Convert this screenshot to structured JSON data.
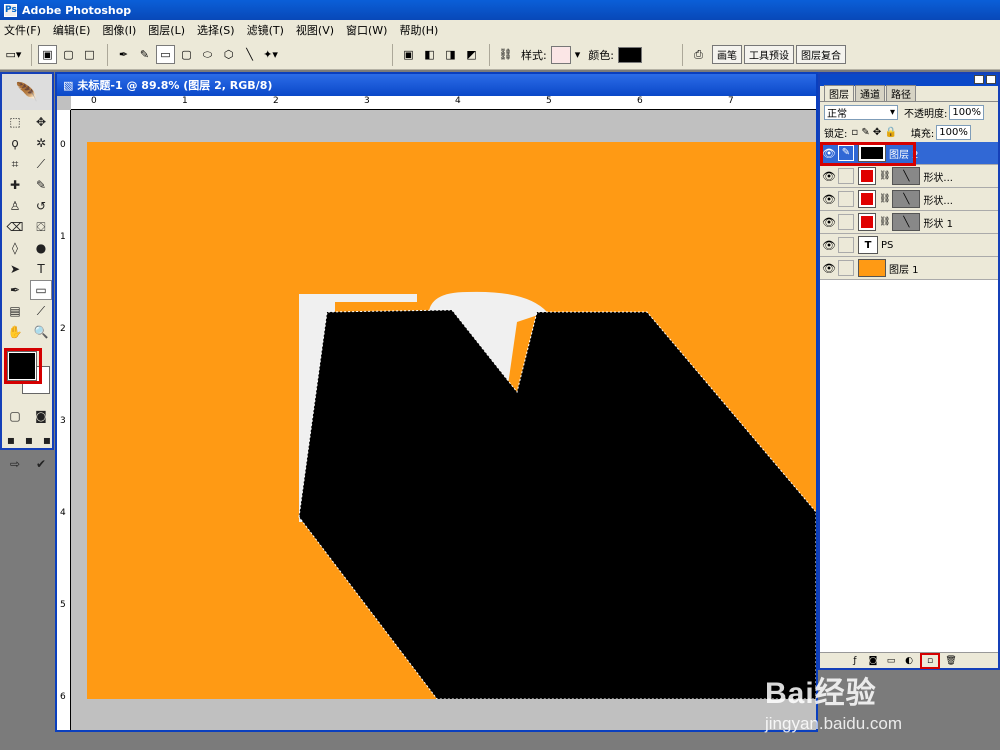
{
  "app": {
    "title": "Adobe Photoshop"
  },
  "menu": [
    "文件(F)",
    "编辑(E)",
    "图像(I)",
    "图层(L)",
    "选择(S)",
    "滤镜(T)",
    "视图(V)",
    "窗口(W)",
    "帮助(H)"
  ],
  "options": {
    "style_label": "样式:",
    "color_label": "颜色:",
    "wells": [
      "画笔",
      "工具预设",
      "图层复合"
    ]
  },
  "document": {
    "title": "未标题-1 @ 89.8% (图层 2, RGB/8)",
    "ruler_top": [
      "0",
      "1",
      "2",
      "3",
      "4",
      "5",
      "6",
      "7"
    ],
    "ruler_left": [
      "0",
      "1",
      "2",
      "3",
      "4",
      "5",
      "6"
    ]
  },
  "layers_panel": {
    "tabs": [
      "图层",
      "通道",
      "路径"
    ],
    "blend_mode": "正常",
    "opacity_label": "不透明度:",
    "opacity": "100%",
    "lock_label": "锁定:",
    "fill_label": "填充:",
    "fill": "100%",
    "layers": [
      {
        "name": "图层 2",
        "selected": true
      },
      {
        "name": "形状...",
        "selected": false
      },
      {
        "name": "形状...",
        "selected": false
      },
      {
        "name": "形状 1",
        "selected": false
      },
      {
        "name": "PS",
        "selected": false
      },
      {
        "name": "图层 1",
        "selected": false
      }
    ]
  },
  "watermark": {
    "brand": "Bai经验",
    "url": "jingyan.baidu.com"
  },
  "colors": {
    "canvas": "#ff9a14",
    "accent": "#0a48c8",
    "highlight": "#d40000"
  }
}
